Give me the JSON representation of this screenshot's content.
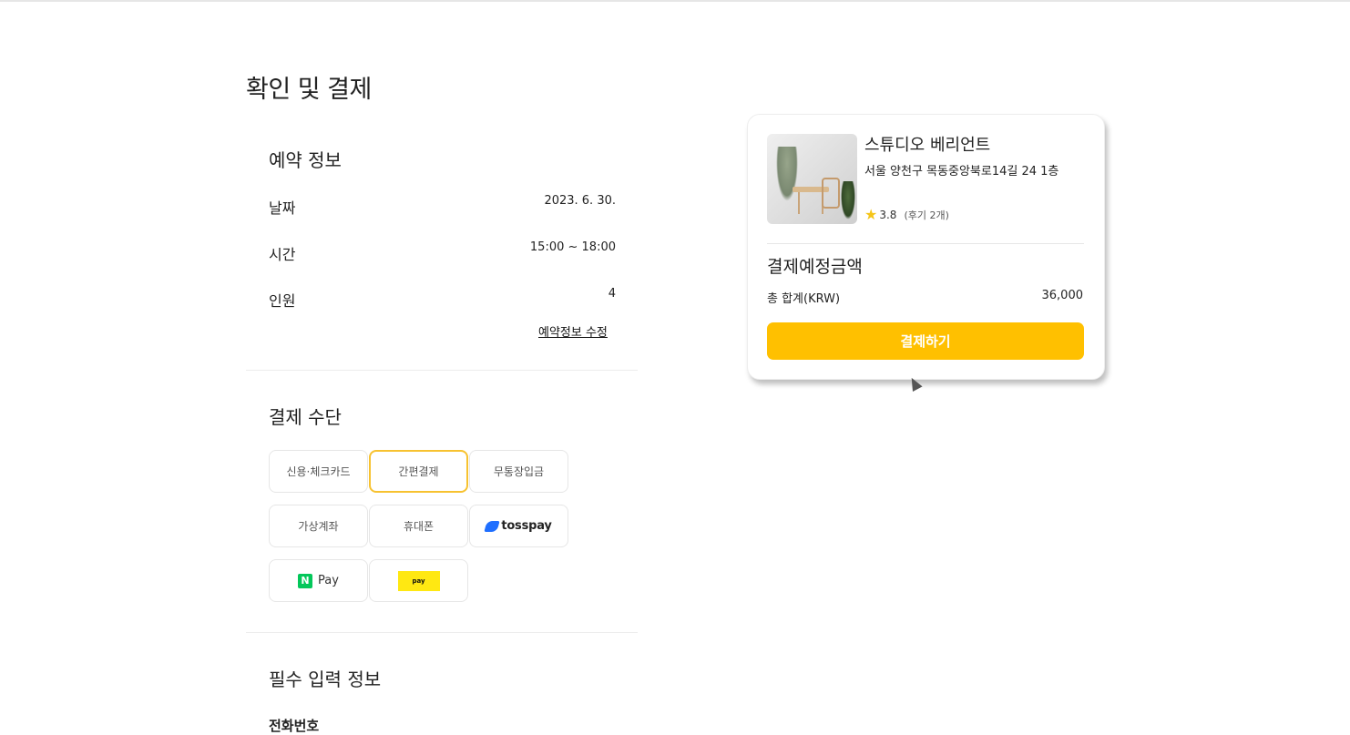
{
  "page": {
    "title": "확인 및 결제"
  },
  "reservation": {
    "section_title": "예약 정보",
    "rows": [
      {
        "label": "날짜",
        "value": "2023. 6. 30."
      },
      {
        "label": "시간",
        "value": "15:00 ~ 18:00"
      },
      {
        "label": "인원",
        "value": "4"
      }
    ],
    "edit_link": "예약정보 수정"
  },
  "payment": {
    "section_title": "결제 수단",
    "methods": [
      {
        "label": "신용·체크카드",
        "selected": false
      },
      {
        "label": "간편결제",
        "selected": true
      },
      {
        "label": "무통장입금",
        "selected": false
      },
      {
        "label": "가상계좌",
        "selected": false
      },
      {
        "label": "휴대폰",
        "selected": false
      },
      {
        "label": "tosspay",
        "selected": false,
        "icon": "toss-icon"
      },
      {
        "label": "Pay",
        "badge": "N",
        "selected": false,
        "icon": "naver-pay-icon"
      },
      {
        "label": "pay",
        "selected": false,
        "icon": "kakao-pay-icon"
      }
    ]
  },
  "required": {
    "section_title": "필수 입력 정보",
    "phone_label": "전화번호"
  },
  "summary": {
    "studio_name": "스튜디오 베리언트",
    "address": "서울 양천구 목동중앙북로14길 24 1층",
    "rating": "3.8",
    "reviews": "(후기 2개)",
    "amount_title": "결제예정금액",
    "total_label": "총 합계(KRW)",
    "total_value": "36,000",
    "pay_button": "결제하기"
  },
  "colors": {
    "accent": "#ffc000",
    "selected_border": "#f7c230",
    "naver_green": "#03c75a",
    "kakao_yellow": "#ffe812",
    "toss_blue": "#1f6fff"
  }
}
